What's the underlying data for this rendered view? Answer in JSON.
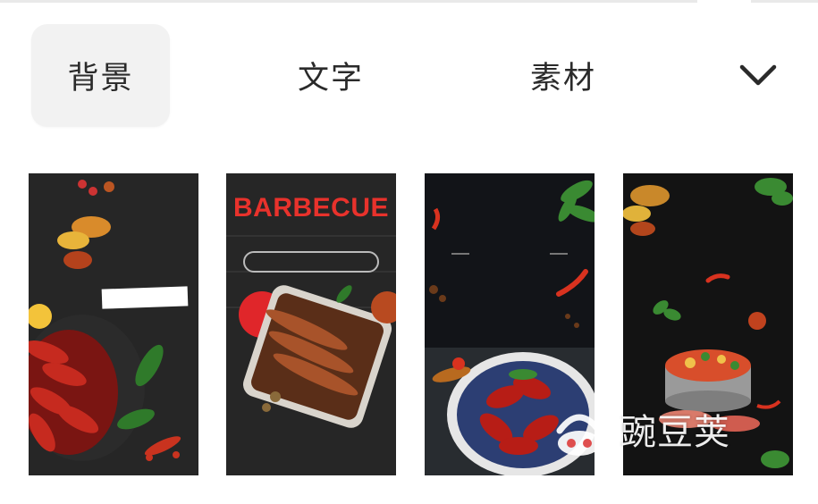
{
  "tabs": [
    {
      "label": "背景",
      "active": true
    },
    {
      "label": "文字",
      "active": false
    },
    {
      "label": "素材",
      "active": false
    }
  ],
  "expand_icon": "chevron-down-icon",
  "templates": [
    {
      "theme": "crayfish"
    },
    {
      "theme": "barbecue",
      "title": "BARBECUE"
    },
    {
      "theme": "crayfish-dark"
    },
    {
      "theme": "hotpot"
    }
  ],
  "watermark": {
    "text": "豌豆荚"
  },
  "colors": {
    "active_tab_bg": "#f2f2f2",
    "tab_text": "#2a2a2a",
    "bbq_red": "#e8322c",
    "thumb_bg": "#1c1c1c"
  }
}
